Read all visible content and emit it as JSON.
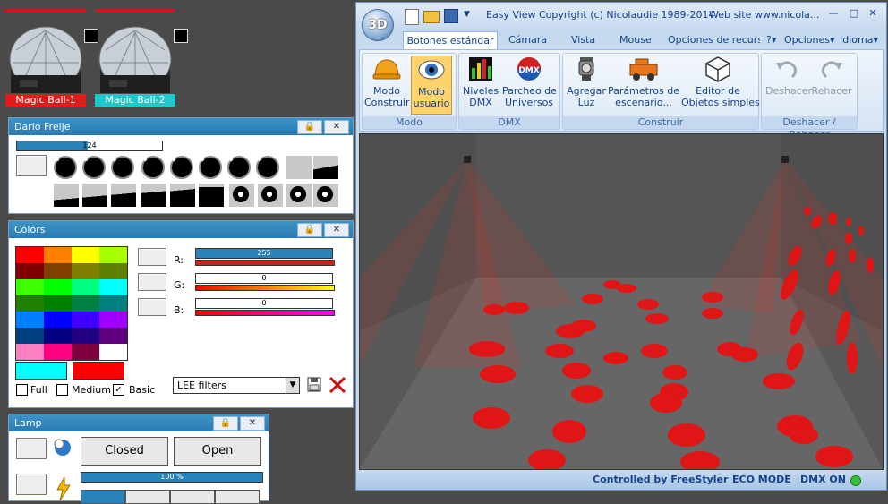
{
  "fixtures": [
    {
      "name": "Magic Ball-1",
      "color": "#e41a1a"
    },
    {
      "name": "Magic Ball-2",
      "color": "#1ec9c9"
    }
  ],
  "dario": {
    "title": "Dario Freije",
    "value": "124",
    "value_fraction": 0.49
  },
  "colors": {
    "title": "Colors",
    "labels": {
      "r": "R:",
      "g": "G:",
      "b": "B:"
    },
    "r": "255",
    "g": "0",
    "b": "0",
    "palette": [
      "#ff0000",
      "#ff8000",
      "#ffff00",
      "#a8ff00",
      "#800000",
      "#804000",
      "#808000",
      "#608000",
      "#40ff00",
      "#00ff00",
      "#00ff80",
      "#00ffff",
      "#208000",
      "#008000",
      "#008040",
      "#008080",
      "#0080ff",
      "#0000ff",
      "#4000ff",
      "#a000ff",
      "#004080",
      "#000080",
      "#200080",
      "#600080",
      "#ff80c0",
      "#ff0080",
      "#800040",
      "#ffffff"
    ],
    "current_color": "#00ffff",
    "previous_color": "#ff0000",
    "options": {
      "full": "Full",
      "medium": "Medium",
      "basic": "Basic"
    },
    "basic_checked": true,
    "filter": "LEE filters"
  },
  "lamp": {
    "title": "Lamp",
    "closed": "Closed",
    "open": "Open",
    "level": "100 %",
    "level_fraction": 1.0
  },
  "app": {
    "title": "Easy View",
    "copyright": "Copyright (c) Nicolaudie 1989-2014",
    "website": "Web site www.nicola...",
    "logo": "3D",
    "tabs": [
      "Botones estándar",
      "Cámara",
      "Vista",
      "Mouse",
      "Opciones de recursc"
    ],
    "active_tab": 0,
    "help": "?",
    "options_menu": "Opciones",
    "language_menu": "Idioma",
    "groups": {
      "modo": "Modo",
      "dmx": "DMX",
      "construir": "Construir",
      "deshacer": "Deshacer / Rehacer"
    },
    "buttons": {
      "modo_construir": "Modo\nConstruir",
      "modo_usuario": "Modo\nusuario",
      "niveles_dmx": "Niveles\nDMX",
      "parcheo": "Parcheo de\nUniversos",
      "agregar_luz": "Agregar\nLuz",
      "parametros": "Parámetros de\nescenario...",
      "editor": "Editor de\nObjetos simples",
      "deshacer": "Deshacer",
      "rehacer": "Rehacer"
    },
    "status": {
      "controlled": "Controlled by FreeStyler",
      "eco": "ECO MODE",
      "dmx": "DMX ON"
    }
  }
}
